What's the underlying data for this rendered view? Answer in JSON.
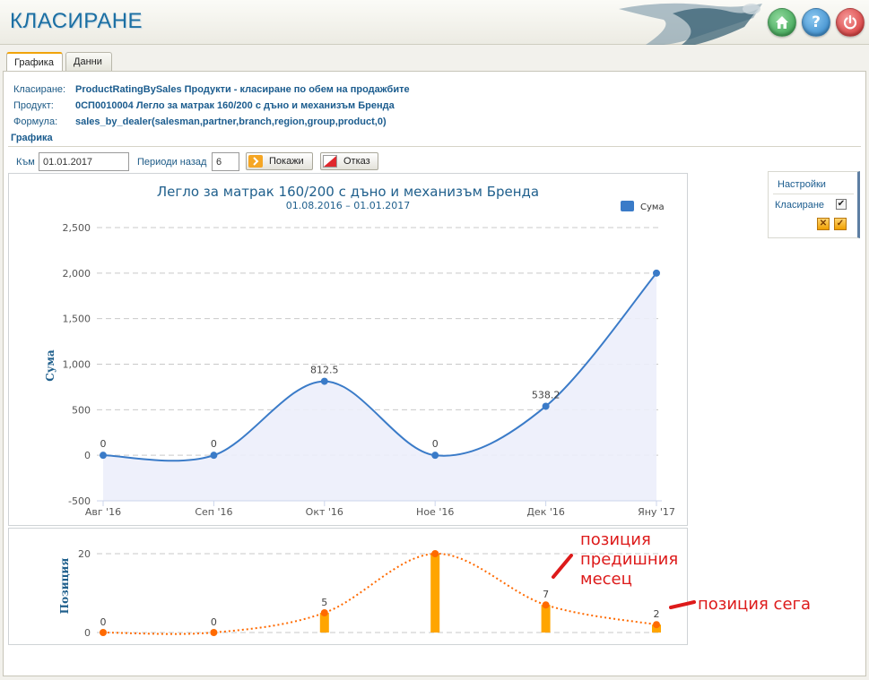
{
  "app": {
    "title": "КЛАСИРАНЕ"
  },
  "tabs": [
    {
      "label": "Графика",
      "active": true
    },
    {
      "label": "Данни",
      "active": false
    }
  ],
  "info": {
    "ranking_label": "Класиране:",
    "ranking_value": "ProductRatingBySales Продукти - класиране по обем на продажбите",
    "product_label": "Продукт:",
    "product_value": "0СП0010004 Легло за матрак 160/200 с дъно и механизъм Бренда",
    "formula_label": "Формула:",
    "formula_value": "sales_by_dealer(salesman,partner,branch,region,group,product,0)"
  },
  "section_title": "Графика",
  "form": {
    "to_label": "Към",
    "to_value": "01.01.2017",
    "periods_label": "Периоди назад",
    "periods_value": "6",
    "show_button": "Покажи",
    "cancel_button": "Отказ"
  },
  "settings": {
    "title": "Настройки",
    "ranking_label": "Класиране",
    "ranking_checked": true,
    "checkmark": "✔"
  },
  "annotations": {
    "previous": "позиция\nпредишния\nмесец",
    "current": "позиция сега"
  },
  "colors": {
    "sales_line": "#3a7bc8",
    "sales_area": "#eceefb",
    "position_bar": "#ffa500",
    "position_line": "#ff6a00",
    "annotation": "#dd1a1a"
  },
  "chart_data": [
    {
      "type": "area",
      "title": "Легло за матрак 160/200 с дъно и механизъм Бренда",
      "subtitle": "01.08.2016 – 01.01.2017",
      "xlabel": "",
      "ylabel": "Сума",
      "categories": [
        "Авг '16",
        "Сеп '16",
        "Окт '16",
        "Ное '16",
        "Дек '16",
        "Яну '17"
      ],
      "series": [
        {
          "name": "Сума",
          "values": [
            0,
            0,
            812.5,
            0,
            538.2,
            2000
          ]
        }
      ],
      "data_labels": [
        "0",
        "0",
        "812.5",
        "0",
        "538.2",
        ""
      ],
      "yticks": [
        "2,500",
        "2,000",
        "1,500",
        "1,000",
        "500",
        "0",
        "-500"
      ],
      "ylim": [
        -500,
        2500
      ],
      "grid": true,
      "legend": "top-right"
    },
    {
      "type": "bar",
      "xlabel": "",
      "ylabel": "Позиция",
      "categories": [
        "Авг '16",
        "Сеп '16",
        "Окт '16",
        "Ное '16",
        "Дек '16",
        "Яну '17"
      ],
      "series": [
        {
          "values": [
            0,
            0,
            5,
            20,
            7,
            2
          ]
        }
      ],
      "data_labels": [
        "0",
        "0",
        "5",
        "",
        "7",
        "2"
      ],
      "yticks": [
        "20",
        "0"
      ],
      "ylim": [
        0,
        20
      ],
      "grid": true
    }
  ]
}
